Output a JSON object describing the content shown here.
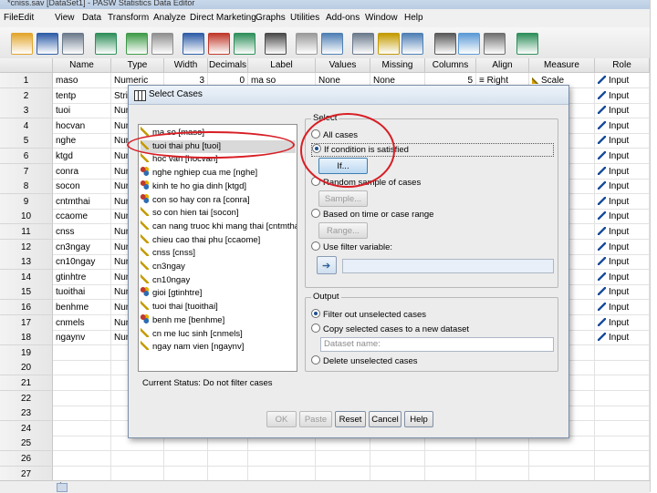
{
  "window": {
    "title": "*cniss.sav [DataSet1] - PASW Statistics Data Editor"
  },
  "menu": [
    "File",
    "Edit",
    "View",
    "Data",
    "Transform",
    "Analyze",
    "Direct Marketing",
    "Graphs",
    "Utilities",
    "Add-ons",
    "Window",
    "Help"
  ],
  "toolbar": [
    "open-icon",
    "save-icon",
    "print-icon",
    "dialog-recall-icon",
    "undo-icon",
    "redo-icon",
    "goto-case-icon",
    "goto-variable-icon",
    "variables-icon",
    "find-icon",
    "insert-cases-icon",
    "insert-variable-icon",
    "split-file-icon",
    "weight-cases-icon",
    "select-cases-icon",
    "value-labels-icon",
    "use-sets-icon",
    "show-all-variables-icon",
    "spell-check-icon"
  ],
  "grid": {
    "columns": [
      "Name",
      "Type",
      "Width",
      "Decimals",
      "Label",
      "Values",
      "Missing",
      "Columns",
      "Align",
      "Measure",
      "Role"
    ],
    "rows": [
      {
        "n": "1",
        "name": "maso",
        "type": "Numeric",
        "width": "3",
        "dec": "0",
        "label": "ma so",
        "values": "None",
        "missing": "None",
        "cols": "5",
        "align": "Right",
        "measure": "Scale",
        "role": "Input"
      },
      {
        "n": "2",
        "name": "tentp",
        "type": "String",
        "width": "",
        "dec": "",
        "label": "",
        "values": "",
        "missing": "",
        "cols": "",
        "align": "",
        "measure": "",
        "role": "Input"
      },
      {
        "n": "3",
        "name": "tuoi",
        "type": "Nume",
        "width": "",
        "dec": "",
        "label": "",
        "values": "",
        "missing": "",
        "cols": "",
        "align": "",
        "measure": "",
        "role": "Input"
      },
      {
        "n": "4",
        "name": "hocvan",
        "type": "Nume",
        "width": "",
        "dec": "",
        "label": "",
        "values": "",
        "missing": "",
        "cols": "",
        "align": "",
        "measure": "",
        "role": "Input"
      },
      {
        "n": "5",
        "name": "nghe",
        "type": "Nume",
        "width": "",
        "dec": "",
        "label": "",
        "values": "",
        "missing": "",
        "cols": "",
        "align": "",
        "measure": "",
        "role": "Input"
      },
      {
        "n": "6",
        "name": "ktgd",
        "type": "Nume",
        "width": "",
        "dec": "",
        "label": "",
        "values": "",
        "missing": "",
        "cols": "",
        "align": "",
        "measure": "",
        "role": "Input"
      },
      {
        "n": "7",
        "name": "conra",
        "type": "Nume",
        "width": "",
        "dec": "",
        "label": "",
        "values": "",
        "missing": "",
        "cols": "",
        "align": "",
        "measure": "",
        "role": "Input"
      },
      {
        "n": "8",
        "name": "socon",
        "type": "Nume",
        "width": "",
        "dec": "",
        "label": "",
        "values": "",
        "missing": "",
        "cols": "",
        "align": "",
        "measure": "",
        "role": "Input"
      },
      {
        "n": "9",
        "name": "cntmthai",
        "type": "Nume",
        "width": "",
        "dec": "",
        "label": "",
        "values": "",
        "missing": "",
        "cols": "",
        "align": "",
        "measure": "",
        "role": "Input"
      },
      {
        "n": "10",
        "name": "ccaome",
        "type": "Nume",
        "width": "",
        "dec": "",
        "label": "",
        "values": "",
        "missing": "",
        "cols": "",
        "align": "",
        "measure": "",
        "role": "Input"
      },
      {
        "n": "11",
        "name": "cnss",
        "type": "Nume",
        "width": "",
        "dec": "",
        "label": "",
        "values": "",
        "missing": "",
        "cols": "",
        "align": "",
        "measure": "",
        "role": "Input"
      },
      {
        "n": "12",
        "name": "cn3ngay",
        "type": "Nume",
        "width": "",
        "dec": "",
        "label": "",
        "values": "",
        "missing": "",
        "cols": "",
        "align": "",
        "measure": "",
        "role": "Input"
      },
      {
        "n": "13",
        "name": "cn10ngay",
        "type": "Nume",
        "width": "",
        "dec": "",
        "label": "",
        "values": "",
        "missing": "",
        "cols": "",
        "align": "",
        "measure": "",
        "role": "Input"
      },
      {
        "n": "14",
        "name": "gtinhtre",
        "type": "Nume",
        "width": "",
        "dec": "",
        "label": "",
        "values": "",
        "missing": "",
        "cols": "",
        "align": "",
        "measure": "",
        "role": "Input"
      },
      {
        "n": "15",
        "name": "tuoithai",
        "type": "Nume",
        "width": "",
        "dec": "",
        "label": "",
        "values": "",
        "missing": "",
        "cols": "",
        "align": "",
        "measure": "",
        "role": "Input"
      },
      {
        "n": "16",
        "name": "benhme",
        "type": "Nume",
        "width": "",
        "dec": "",
        "label": "",
        "values": "",
        "missing": "",
        "cols": "",
        "align": "",
        "measure": "",
        "role": "Input"
      },
      {
        "n": "17",
        "name": "cnmels",
        "type": "Nume",
        "width": "",
        "dec": "",
        "label": "",
        "values": "",
        "missing": "",
        "cols": "",
        "align": "",
        "measure": "",
        "role": "Input"
      },
      {
        "n": "18",
        "name": "ngaynv",
        "type": "Nume",
        "width": "",
        "dec": "",
        "label": "",
        "values": "",
        "missing": "",
        "cols": "",
        "align": "",
        "measure": "",
        "role": "Input"
      },
      {
        "n": "19"
      },
      {
        "n": "20"
      },
      {
        "n": "21"
      },
      {
        "n": "22"
      },
      {
        "n": "23"
      },
      {
        "n": "24"
      },
      {
        "n": "25"
      },
      {
        "n": "26"
      },
      {
        "n": "27"
      }
    ],
    "hscroll_label": "1"
  },
  "dialog": {
    "title": "Select Cases",
    "variables": [
      {
        "label": "ma so [maso]",
        "kind": "scale"
      },
      {
        "label": "tuoi thai phu [tuoi]",
        "kind": "scale",
        "selected": true
      },
      {
        "label": "hoc van [hocvan]",
        "kind": "scale"
      },
      {
        "label": "nghe nghiep cua me [nghe]",
        "kind": "nominal"
      },
      {
        "label": "kinh te ho gia dinh [ktgd]",
        "kind": "nominal"
      },
      {
        "label": "con so hay con ra [conra]",
        "kind": "nominal"
      },
      {
        "label": "so con hien tai [socon]",
        "kind": "scale"
      },
      {
        "label": "can nang truoc khi mang thai [cntmthai]",
        "kind": "scale"
      },
      {
        "label": "chieu cao thai phu [ccaome]",
        "kind": "scale"
      },
      {
        "label": "cnss [cnss]",
        "kind": "scale"
      },
      {
        "label": "cn3ngay",
        "kind": "scale"
      },
      {
        "label": "cn10ngay",
        "kind": "scale"
      },
      {
        "label": "gioi [gtinhtre]",
        "kind": "nominal"
      },
      {
        "label": "tuoi thai [tuoithai]",
        "kind": "scale"
      },
      {
        "label": "benh me [benhme]",
        "kind": "nominal"
      },
      {
        "label": "cn me luc sinh [cnmels]",
        "kind": "scale"
      },
      {
        "label": "ngay nam vien [ngaynv]",
        "kind": "scale"
      }
    ],
    "status": "Current Status: Do not filter cases",
    "select": {
      "legend": "Select",
      "all_cases": "All cases",
      "if_condition": "If condition is satisfied",
      "if_button": "If...",
      "random": "Random sample of cases",
      "sample_button": "Sample...",
      "time_range": "Based on time or case range",
      "range_button": "Range...",
      "filter": "Use filter variable:"
    },
    "output": {
      "legend": "Output",
      "filter_out": "Filter out unselected cases",
      "copy": "Copy selected cases to a new dataset",
      "dataset_name": "Dataset name:",
      "delete": "Delete unselected cases"
    },
    "buttons": {
      "ok": "OK",
      "paste": "Paste",
      "reset": "Reset",
      "cancel": "Cancel",
      "help": "Help"
    }
  },
  "colors": {
    "annotation": "#d81e25",
    "selection": "#d9d9d9",
    "role_icon": "#1b4f9c"
  }
}
